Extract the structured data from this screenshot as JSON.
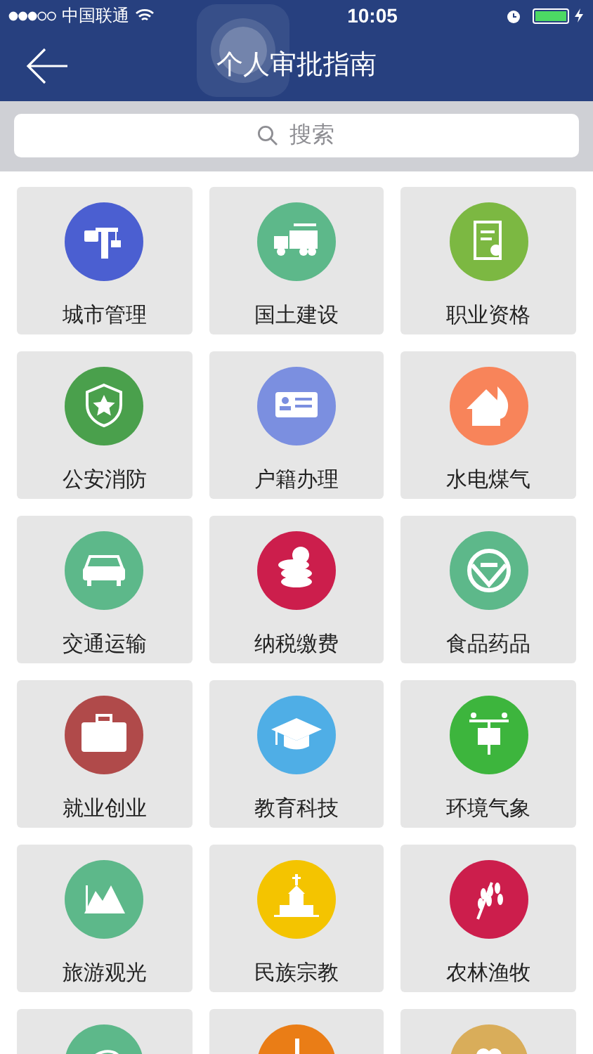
{
  "status_bar": {
    "carrier": "中国联通",
    "time": "10:05"
  },
  "nav": {
    "title": "个人审批指南"
  },
  "search": {
    "placeholder": "搜索"
  },
  "tiles": [
    {
      "label": "城市管理",
      "color": "#4b5fd1"
    },
    {
      "label": "国土建设",
      "color": "#5db88a"
    },
    {
      "label": "职业资格",
      "color": "#7cb842"
    },
    {
      "label": "公安消防",
      "color": "#4aa04c"
    },
    {
      "label": "户籍办理",
      "color": "#7b8fe0"
    },
    {
      "label": "水电煤气",
      "color": "#f8845a"
    },
    {
      "label": "交通运输",
      "color": "#5db88a"
    },
    {
      "label": "纳税缴费",
      "color": "#cc1e4c"
    },
    {
      "label": "食品药品",
      "color": "#5db88a"
    },
    {
      "label": "就业创业",
      "color": "#b04a4a"
    },
    {
      "label": "教育科技",
      "color": "#4faee6"
    },
    {
      "label": "环境气象",
      "color": "#3db53d"
    },
    {
      "label": "旅游观光",
      "color": "#5db88a"
    },
    {
      "label": "民族宗教",
      "color": "#f4c400"
    },
    {
      "label": "农林渔牧",
      "color": "#cc1e4c"
    },
    {
      "color": "#5db88a"
    },
    {
      "color": "#ea7d16"
    },
    {
      "color": "#d9ad5a"
    }
  ]
}
